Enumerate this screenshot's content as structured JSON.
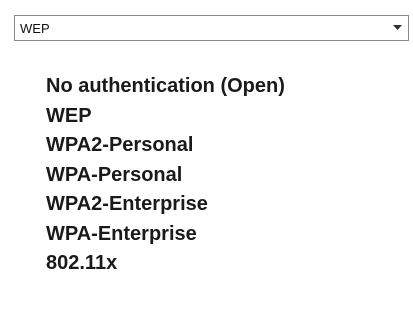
{
  "select": {
    "selected_value": "WEP",
    "arrow_icon": "dropdown-arrow-icon"
  },
  "options": [
    "No authentication (Open)",
    "WEP",
    "WPA2-Personal",
    "WPA-Personal",
    "WPA2-Enterprise",
    "WPA-Enterprise",
    "802.11x"
  ]
}
